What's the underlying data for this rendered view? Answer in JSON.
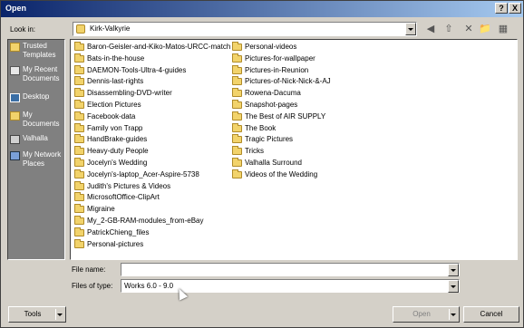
{
  "window": {
    "title": "Open",
    "help_label": "?",
    "close_label": "X"
  },
  "lookin": {
    "label": "Look in:",
    "value": "Kirk-Valkyrie"
  },
  "toolbar": {
    "icons": [
      "back-icon",
      "up-folder-icon",
      "delete-icon",
      "new-folder-icon",
      "views-icon"
    ]
  },
  "places": [
    {
      "label": "Trusted Templates",
      "icon": "folder-icon"
    },
    {
      "label": "My Recent Documents",
      "icon": "recent-icon"
    },
    {
      "label": "Desktop",
      "icon": "desktop-icon"
    },
    {
      "label": "My Documents",
      "icon": "folder-icon"
    },
    {
      "label": "Valhalla",
      "icon": "drive-icon"
    },
    {
      "label": "My Network Places",
      "icon": "network-icon"
    }
  ],
  "files_col1": [
    "Baron-Geisler-and-Kiko-Matos-URCC-match",
    "Bats-in-the-house",
    "DAEMON-Tools-Ultra-4-guides",
    "Dennis-last-rights",
    "Disassembling-DVD-writer",
    "Election Pictures",
    "Facebook-data",
    "Family von Trapp",
    "HandBrake-guides",
    "Heavy-duty People",
    "Jocelyn's Wedding",
    "Jocelyn's-laptop_Acer-Aspire-5738",
    "Judith's Pictures & Videos",
    "MicrosoftOffice-ClipArt",
    "Migraine",
    "My_2-GB-RAM-modules_from-eBay",
    "PatrickChieng_files",
    "Personal-pictures"
  ],
  "files_col2": [
    "Personal-videos",
    "Pictures-for-wallpaper",
    "Pictures-in-Reunion",
    "Pictures-of-Nick-Nick-&-AJ",
    "Rowena-Dacuma",
    "Snapshot-pages",
    "The Best of AIR SUPPLY",
    "The Book",
    "Tragic Pictures",
    "Tricks",
    "Valhalla Surround",
    "Videos of the Wedding"
  ],
  "filename": {
    "label": "File name:",
    "value": ""
  },
  "filetype": {
    "label": "Files of type:",
    "value": "Works 6.0 - 9.0"
  },
  "buttons": {
    "tools": "Tools",
    "open": "Open",
    "cancel": "Cancel"
  }
}
